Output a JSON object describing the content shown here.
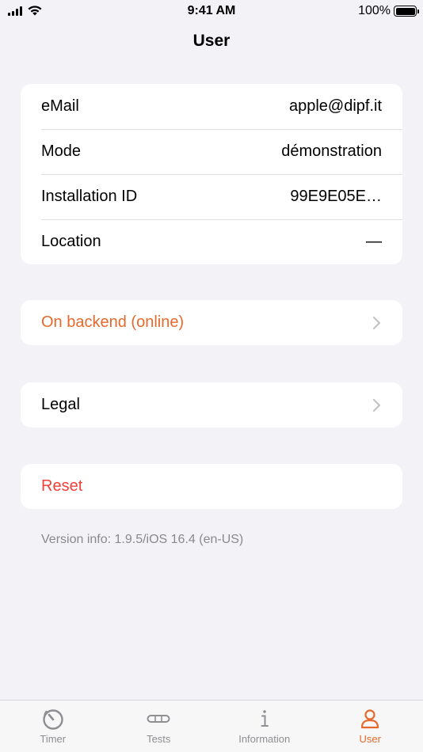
{
  "status_bar": {
    "time": "9:41 AM",
    "battery": "100%"
  },
  "nav": {
    "title": "User"
  },
  "info_rows": [
    {
      "label": "eMail",
      "value": "apple@dipf.it"
    },
    {
      "label": "Mode",
      "value": "démonstration"
    },
    {
      "label": "Installation ID",
      "value": "99E9E05E…"
    },
    {
      "label": "Location",
      "value": "—"
    }
  ],
  "backend": {
    "label": "On backend (online)"
  },
  "legal": {
    "label": "Legal"
  },
  "reset": {
    "label": "Reset"
  },
  "version_info": "Version info: 1.9.5/iOS 16.4 (en-US)",
  "tabs": [
    {
      "label": "Timer",
      "icon": "timer-icon"
    },
    {
      "label": "Tests",
      "icon": "tests-icon"
    },
    {
      "label": "Information",
      "icon": "info-icon"
    },
    {
      "label": "User",
      "icon": "user-icon"
    }
  ],
  "colors": {
    "accent": "#e5692c",
    "destructive": "#f0413a",
    "background": "#f2f2f7",
    "tab_inactive": "#8e8e93"
  }
}
